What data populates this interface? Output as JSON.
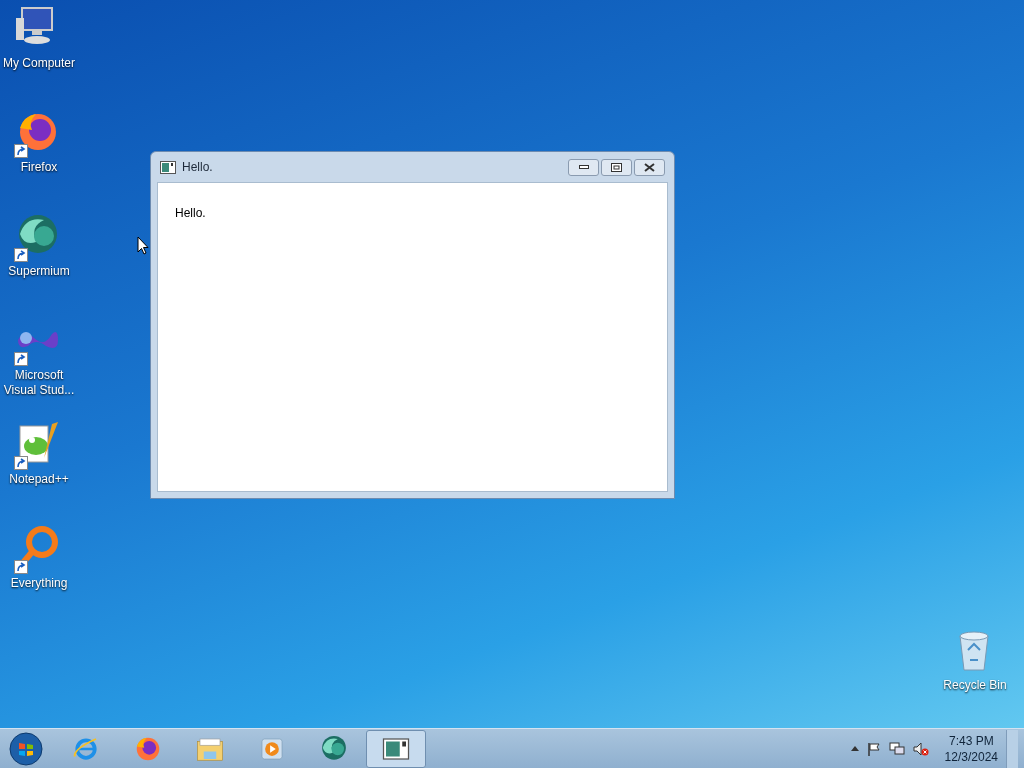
{
  "desktop_icons": [
    {
      "label": "My Computer",
      "kind": "computer",
      "shortcut": false
    },
    {
      "label": "Firefox",
      "kind": "firefox",
      "shortcut": true
    },
    {
      "label": "Supermium",
      "kind": "supermium",
      "shortcut": true
    },
    {
      "label": "Microsoft Visual Stud...",
      "kind": "vs",
      "shortcut": true
    },
    {
      "label": "Notepad++",
      "kind": "notepad",
      "shortcut": true
    },
    {
      "label": "Everything",
      "kind": "everything",
      "shortcut": true
    },
    {
      "label": "Recycle Bin",
      "kind": "recycle",
      "shortcut": false
    }
  ],
  "window": {
    "title": "Hello.",
    "body_text": "Hello."
  },
  "taskbar": {
    "items": [
      {
        "kind": "ie",
        "selected": false
      },
      {
        "kind": "firefox",
        "selected": false
      },
      {
        "kind": "explorer",
        "selected": false
      },
      {
        "kind": "media",
        "selected": false
      },
      {
        "kind": "supermium",
        "selected": false
      },
      {
        "kind": "app",
        "selected": true
      }
    ]
  },
  "tray": {
    "time": "7:43 PM",
    "date": "12/3/2024"
  }
}
